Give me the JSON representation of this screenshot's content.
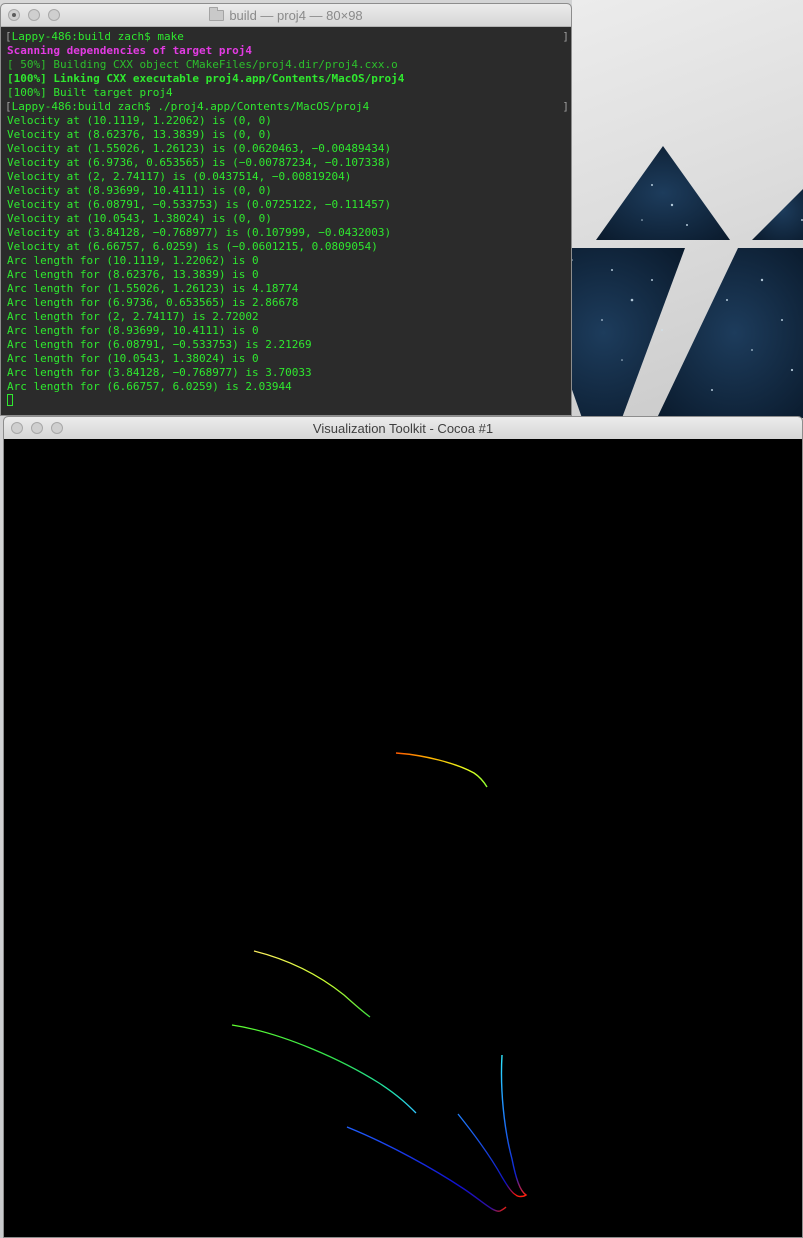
{
  "terminal": {
    "title": "build — proj4 — 80×98",
    "lines": [
      {
        "text": "Lappy-486:build zach$ make",
        "kind": "prompt"
      },
      {
        "text": "Scanning dependencies of target proj4",
        "kind": "magenta"
      },
      {
        "text": "[ 50%] Building CXX object CMakeFiles/proj4.dir/proj4.cxx.o",
        "kind": "dim"
      },
      {
        "text": "[100%] Linking CXX executable proj4.app/Contents/MacOS/proj4",
        "kind": "bold"
      },
      {
        "text": "[100%] Built target proj4",
        "kind": "normal"
      },
      {
        "text": "Lappy-486:build zach$ ./proj4.app/Contents/MacOS/proj4",
        "kind": "prompt"
      },
      {
        "text": "Velocity at (10.1119, 1.22062) is (0, 0)",
        "kind": "normal"
      },
      {
        "text": "Velocity at (8.62376, 13.3839) is (0, 0)",
        "kind": "normal"
      },
      {
        "text": "Velocity at (1.55026, 1.26123) is (0.0620463, −0.00489434)",
        "kind": "normal"
      },
      {
        "text": "Velocity at (6.9736, 0.653565) is (−0.00787234, −0.107338)",
        "kind": "normal"
      },
      {
        "text": "Velocity at (2, 2.74117) is (0.0437514, −0.00819204)",
        "kind": "normal"
      },
      {
        "text": "Velocity at (8.93699, 10.4111) is (0, 0)",
        "kind": "normal"
      },
      {
        "text": "Velocity at (6.08791, −0.533753) is (0.0725122, −0.111457)",
        "kind": "normal"
      },
      {
        "text": "Velocity at (10.0543, 1.38024) is (0, 0)",
        "kind": "normal"
      },
      {
        "text": "Velocity at (3.84128, −0.768977) is (0.107999, −0.0432003)",
        "kind": "normal"
      },
      {
        "text": "Velocity at (6.66757, 6.0259) is (−0.0601215, 0.0809054)",
        "kind": "normal"
      },
      {
        "text": "Arc length for (10.1119, 1.22062) is 0",
        "kind": "normal"
      },
      {
        "text": "Arc length for (8.62376, 13.3839) is 0",
        "kind": "normal"
      },
      {
        "text": "Arc length for (1.55026, 1.26123) is 4.18774",
        "kind": "normal"
      },
      {
        "text": "Arc length for (6.9736, 0.653565) is 2.86678",
        "kind": "normal"
      },
      {
        "text": "Arc length for (2, 2.74117) is 2.72002",
        "kind": "normal"
      },
      {
        "text": "Arc length for (8.93699, 10.4111) is 0",
        "kind": "normal"
      },
      {
        "text": "Arc length for (6.08791, −0.533753) is 2.21269",
        "kind": "normal"
      },
      {
        "text": "Arc length for (10.0543, 1.38024) is 0",
        "kind": "normal"
      },
      {
        "text": "Arc length for (3.84128, −0.768977) is 3.70033",
        "kind": "normal"
      },
      {
        "text": "Arc length for (6.66757, 6.0259) is 2.03944",
        "kind": "normal"
      }
    ],
    "colors": {
      "text": "#2fe82f",
      "magenta": "#e23be2",
      "background": "#2b2b2b"
    }
  },
  "vtk": {
    "title": "Visualization Toolkit - Cocoa #1",
    "background": "#000000"
  }
}
